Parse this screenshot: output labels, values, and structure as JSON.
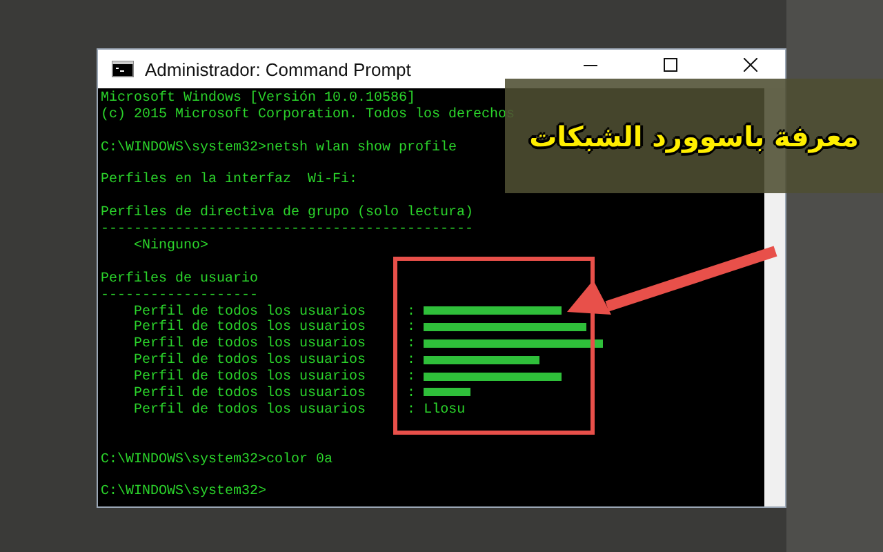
{
  "window": {
    "title": "Administrador: Command Prompt"
  },
  "console_lines": [
    {
      "kind": "text",
      "text": "Microsoft Windows [Versión 10.0.10586]"
    },
    {
      "kind": "text",
      "text": "(c) 2015 Microsoft Corporation. Todos los derechos"
    },
    {
      "kind": "blank"
    },
    {
      "kind": "text",
      "text": "C:\\WINDOWS\\system32>netsh wlan show profile"
    },
    {
      "kind": "blank"
    },
    {
      "kind": "text",
      "text": "Perfiles en la interfaz  Wi-Fi:"
    },
    {
      "kind": "blank"
    },
    {
      "kind": "text",
      "text": "Perfiles de directiva de grupo (solo lectura)"
    },
    {
      "kind": "text",
      "text": "---------------------------------------------"
    },
    {
      "kind": "text",
      "text": "    <Ninguno>"
    },
    {
      "kind": "blank"
    },
    {
      "kind": "text",
      "text": "Perfiles de usuario"
    },
    {
      "kind": "text",
      "text": "-------------------"
    },
    {
      "kind": "profile",
      "label": "    Perfil de todos los usuarios     :",
      "redacted": true
    },
    {
      "kind": "profile",
      "label": "    Perfil de todos los usuarios     :",
      "redacted": true
    },
    {
      "kind": "profile",
      "label": "    Perfil de todos los usuarios     :",
      "redacted": true
    },
    {
      "kind": "profile",
      "label": "    Perfil de todos los usuarios     :",
      "redacted": true
    },
    {
      "kind": "profile",
      "label": "    Perfil de todos los usuarios     :",
      "redacted": true
    },
    {
      "kind": "profile",
      "label": "    Perfil de todos los usuarios     :",
      "redacted": true
    },
    {
      "kind": "profile",
      "label": "    Perfil de todos los usuarios     :",
      "redacted": false,
      "name": "Llosu"
    },
    {
      "kind": "blank"
    },
    {
      "kind": "blank"
    },
    {
      "kind": "text",
      "text": "C:\\WINDOWS\\system32>color 0a"
    },
    {
      "kind": "blank"
    },
    {
      "kind": "text",
      "text": "C:\\WINDOWS\\system32>"
    }
  ],
  "banner": {
    "text": "معرفة باسوورد الشبكات"
  }
}
